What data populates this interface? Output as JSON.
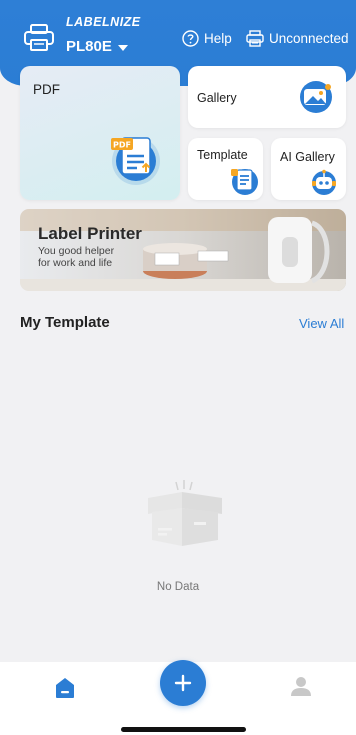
{
  "header": {
    "brand": "LABELNIZE",
    "model": "PL80E",
    "help_label": "Help",
    "connection_label": "Unconnected"
  },
  "cards": {
    "pdf_label": "PDF",
    "gallery_label": "Gallery",
    "template_label": "Template",
    "ai_gallery_label": "AI Gallery"
  },
  "banner": {
    "title": "Label Printer",
    "subtitle_line1": "You good helper",
    "subtitle_line2": "for work and life"
  },
  "my_template": {
    "title": "My Template",
    "view_all": "View All",
    "empty_text": "No Data"
  },
  "colors": {
    "accent": "#2b7dd4",
    "background": "#f1f1f3"
  },
  "icons": {
    "printer": "printer-icon",
    "help": "help-circle-icon",
    "connection": "printer-connection-icon",
    "home": "home-icon",
    "add": "plus-icon",
    "user": "user-icon"
  }
}
